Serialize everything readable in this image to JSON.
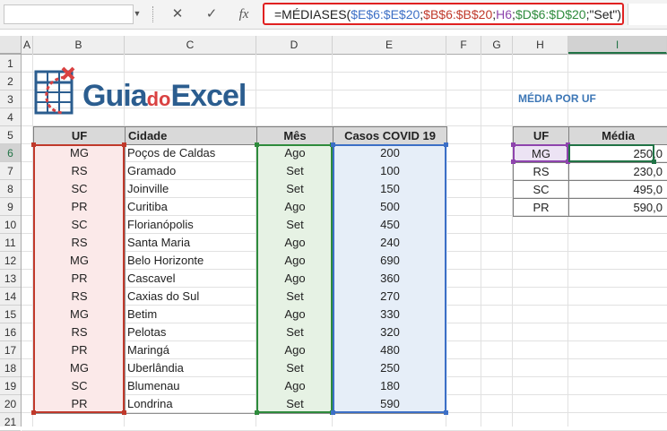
{
  "name_box": "",
  "formula_bar": {
    "cancel_icon": "✕",
    "enter_icon": "✓",
    "fx_label": "fx",
    "formula_parts": [
      {
        "text": "=MÉDIASES(",
        "color": "#222222"
      },
      {
        "text": "$E$6:$E$20",
        "color": "#3c6fc6"
      },
      {
        "text": ";",
        "color": "#222222"
      },
      {
        "text": "$B$6:$B$20",
        "color": "#c0392b"
      },
      {
        "text": ";",
        "color": "#222222"
      },
      {
        "text": "H6",
        "color": "#8e44ad"
      },
      {
        "text": ";",
        "color": "#222222"
      },
      {
        "text": "$D$6:$D$20",
        "color": "#2e8b3c"
      },
      {
        "text": ";\"Set\")",
        "color": "#222222"
      }
    ]
  },
  "columns": [
    "A",
    "B",
    "C",
    "D",
    "E",
    "F",
    "G",
    "H",
    "I"
  ],
  "rows": [
    "1",
    "2",
    "3",
    "4",
    "5",
    "6",
    "7",
    "8",
    "9",
    "10",
    "11",
    "12",
    "13",
    "14",
    "15",
    "16",
    "17",
    "18",
    "19",
    "20",
    "21"
  ],
  "logo": {
    "part1": "Guia",
    "part2": "do",
    "part3": "Excel"
  },
  "media_title": "MÉDIA POR UF",
  "data_table": {
    "headers": {
      "uf": "UF",
      "cidade": "Cidade",
      "mes": "Mês",
      "casos": "Casos COVID 19"
    },
    "rows": [
      {
        "uf": "MG",
        "cidade": "Poços de Caldas",
        "mes": "Ago",
        "casos": "200"
      },
      {
        "uf": "RS",
        "cidade": "Gramado",
        "mes": "Set",
        "casos": "100"
      },
      {
        "uf": "SC",
        "cidade": "Joinville",
        "mes": "Set",
        "casos": "150"
      },
      {
        "uf": "PR",
        "cidade": "Curitiba",
        "mes": "Ago",
        "casos": "500"
      },
      {
        "uf": "SC",
        "cidade": "Florianópolis",
        "mes": "Set",
        "casos": "450"
      },
      {
        "uf": "RS",
        "cidade": "Santa Maria",
        "mes": "Ago",
        "casos": "240"
      },
      {
        "uf": "MG",
        "cidade": "Belo Horizonte",
        "mes": "Ago",
        "casos": "690"
      },
      {
        "uf": "PR",
        "cidade": "Cascavel",
        "mes": "Ago",
        "casos": "360"
      },
      {
        "uf": "RS",
        "cidade": "Caxias do Sul",
        "mes": "Set",
        "casos": "270"
      },
      {
        "uf": "MG",
        "cidade": "Betim",
        "mes": "Ago",
        "casos": "330"
      },
      {
        "uf": "RS",
        "cidade": "Pelotas",
        "mes": "Set",
        "casos": "320"
      },
      {
        "uf": "PR",
        "cidade": "Maringá",
        "mes": "Ago",
        "casos": "480"
      },
      {
        "uf": "MG",
        "cidade": "Uberlândia",
        "mes": "Set",
        "casos": "250"
      },
      {
        "uf": "SC",
        "cidade": "Blumenau",
        "mes": "Ago",
        "casos": "180"
      },
      {
        "uf": "PR",
        "cidade": "Londrina",
        "mes": "Set",
        "casos": "590"
      }
    ]
  },
  "summary_table": {
    "headers": {
      "uf": "UF",
      "media": "Média"
    },
    "rows": [
      {
        "uf": "MG",
        "media": "250,0"
      },
      {
        "uf": "RS",
        "media": "230,0"
      },
      {
        "uf": "SC",
        "media": "495,0"
      },
      {
        "uf": "PR",
        "media": "590,0"
      }
    ]
  },
  "colors": {
    "uf_range": "#c0392b",
    "month_range": "#2e8b3c",
    "cases_range": "#3c6fc6",
    "criteria_cell": "#8e44ad",
    "active_cell": "#217346"
  }
}
